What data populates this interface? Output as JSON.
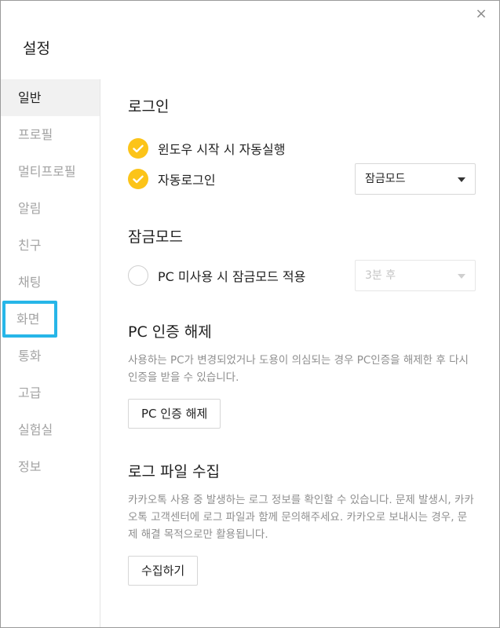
{
  "window": {
    "title": "설정",
    "close_icon": "×"
  },
  "sidebar": {
    "items": [
      {
        "label": "일반"
      },
      {
        "label": "프로필"
      },
      {
        "label": "멀티프로필"
      },
      {
        "label": "알림"
      },
      {
        "label": "친구"
      },
      {
        "label": "채팅"
      },
      {
        "label": "화면"
      },
      {
        "label": "통화"
      },
      {
        "label": "고급"
      },
      {
        "label": "실험실"
      },
      {
        "label": "정보"
      }
    ]
  },
  "login": {
    "title": "로그인",
    "autostart_label": "윈도우 시작 시 자동실행",
    "autologin_label": "자동로그인",
    "autologin_select": "잠금모드"
  },
  "lockmode": {
    "title": "잠금모드",
    "idle_label": "PC 미사용 시 잠금모드 적용",
    "idle_select": "3분 후"
  },
  "pc_auth": {
    "title": "PC 인증 해제",
    "description": "사용하는 PC가 변경되었거나 도용이 의심되는 경우 PC인증을 해제한 후 다시 인증을 받을 수 있습니다.",
    "button": "PC 인증 해제"
  },
  "log": {
    "title": "로그 파일 수집",
    "description": "카카오톡 사용 중 발생하는 로그 정보를 확인할 수 있습니다. 문제 발생시, 카카오톡 고객센터에 로그 파일과 함께 문의해주세요. 카카오로 보내시는 경우, 문제 해결 목적으로만 활용됩니다.",
    "button": "수집하기"
  },
  "colors": {
    "accent": "#fcc419",
    "focus": "#27b6e8"
  }
}
